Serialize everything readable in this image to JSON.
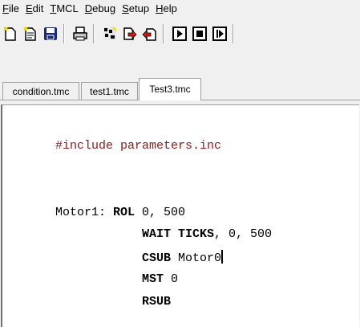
{
  "menu": [
    {
      "pre": "",
      "u": "F",
      "post": "ile"
    },
    {
      "pre": "",
      "u": "E",
      "post": "dit"
    },
    {
      "pre": "",
      "u": "T",
      "post": "MCL"
    },
    {
      "pre": "",
      "u": "D",
      "post": "ebug"
    },
    {
      "pre": "",
      "u": "S",
      "post": "etup"
    },
    {
      "pre": "",
      "u": "H",
      "post": "elp"
    }
  ],
  "toolbar": {
    "icons": [
      "new-file-icon",
      "open-file-icon",
      "save-icon",
      "print-icon",
      "assemble-icon",
      "download-icon",
      "upload-icon",
      "run-icon",
      "stop-icon",
      "step-icon"
    ]
  },
  "tabs": [
    {
      "label": "condition.tmc",
      "active": false
    },
    {
      "label": "test1.tmc",
      "active": false
    },
    {
      "label": "Test3.tmc",
      "active": true
    }
  ],
  "editor": {
    "include_line": "#include parameters.inc",
    "label": "Motor1:",
    "lines": [
      {
        "cmd": "ROL",
        "args": " 0, 500"
      },
      {
        "cmd": "WAIT TICKS",
        "args": ", 0, 500"
      },
      {
        "cmd": "CSUB",
        "args": " Motor0"
      },
      {
        "cmd": "MST",
        "args": " 0"
      },
      {
        "cmd": "RSUB",
        "args": ""
      }
    ]
  },
  "colors": {
    "directive": "#8b1a1a",
    "toolbar_red": "#d01818",
    "toolbar_yellow": "#f4d800",
    "toolbar_blue": "#1a2a80"
  }
}
